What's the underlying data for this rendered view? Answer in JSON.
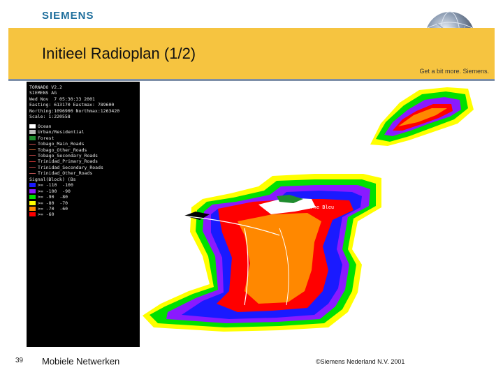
{
  "header": {
    "logo_text": "SIEMENS",
    "title": "Initieel Radioplan (1/2)",
    "tagline": "Get a bit more. Siemens.",
    "banner_color": "#f6c440"
  },
  "legend": {
    "header_lines": [
      "TORNADO V2.2",
      "SIEMENS AG",
      "Wed Nov  7 05:30:33 2001",
      "Easting: 613170 Eastmax: 789600",
      "Northing:1096900 Northmax:1263420",
      "Scale: 1:220558"
    ],
    "classes": [
      {
        "label": "Ocean",
        "color": "#ffffff"
      },
      {
        "label": "Urban/Residential",
        "color": "#bbbbbb"
      },
      {
        "label": "Forest",
        "color": "#1f8c2e"
      }
    ],
    "roads": [
      {
        "label": "Tobago_Main_Roads",
        "color": "#d05050"
      },
      {
        "label": "Tobago_Other_Roads",
        "color": "#c06030"
      },
      {
        "label": "Tobago_Secondary_Roads",
        "color": "#b04040"
      },
      {
        "label": "Trinidad_Primary_Roads",
        "color": "#c03030"
      },
      {
        "label": "Trinidad_Secondary_Roads",
        "color": "#c04848"
      },
      {
        "label": "Trinidad_Other_Roads",
        "color": "#b05050"
      }
    ],
    "signal_title": "Signal(Block) (Bs",
    "signal_levels": [
      {
        "op": ">=",
        "from": "-110",
        "to": "-100",
        "color": "#1a1aff"
      },
      {
        "op": ">=",
        "from": "-100",
        "to": "-90",
        "color": "#8a1aff"
      },
      {
        "op": ">=",
        "from": "-90",
        "to": "-80",
        "color": "#00e000"
      },
      {
        "op": ">=",
        "from": "-80",
        "to": "-70",
        "color": "#ffff00"
      },
      {
        "op": ">=",
        "from": "-70",
        "to": "-60",
        "color": "#ff8800"
      },
      {
        "op": ">=",
        "from": "-60",
        "to": "",
        "color": "#ff0000"
      }
    ]
  },
  "map": {
    "place_label": "Morne Bleu"
  },
  "footer": {
    "slide_number": "39",
    "course": "Mobiele Netwerken",
    "copyright": "©Siemens Nederland N.V. 2001"
  }
}
